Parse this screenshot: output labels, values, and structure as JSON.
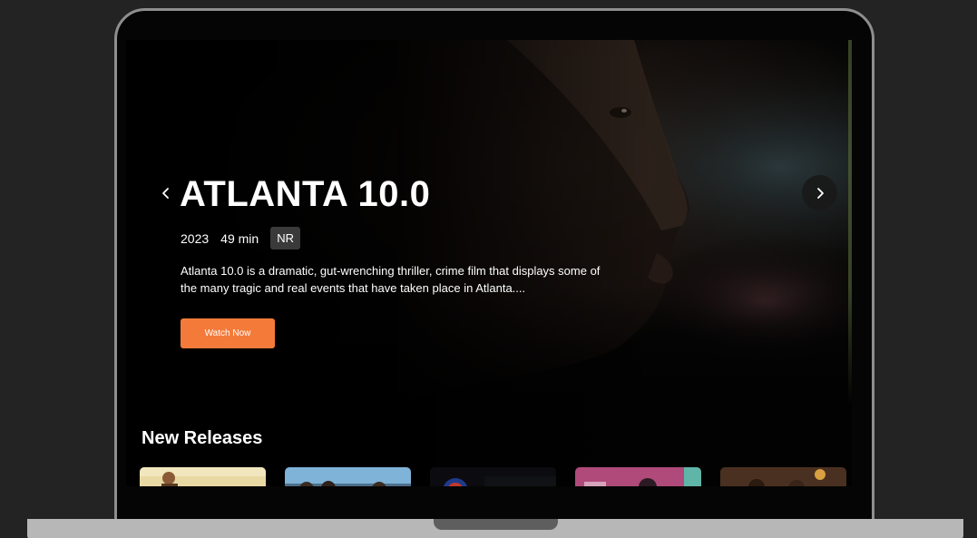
{
  "hero": {
    "title": "ATLANTA 10.0",
    "year": "2023",
    "duration": "49 min",
    "rating": "NR",
    "description": "Atlanta 10.0 is a dramatic, gut-wrenching thriller, crime film that displays some of the many tragic and real events that have taken place in Atlanta....",
    "watch_label": "Watch Now",
    "prev_icon": "chevron-left-icon",
    "next_icon": "chevron-right-icon"
  },
  "new_releases": {
    "title": "New Releases",
    "items": [
      {
        "name": "release-1"
      },
      {
        "name": "release-2"
      },
      {
        "name": "release-3"
      },
      {
        "name": "release-4"
      },
      {
        "name": "release-5"
      }
    ]
  },
  "colors": {
    "accent": "#f47a3a",
    "background": "#020202",
    "text": "#ffffff",
    "badge": "#3a3a3a"
  }
}
